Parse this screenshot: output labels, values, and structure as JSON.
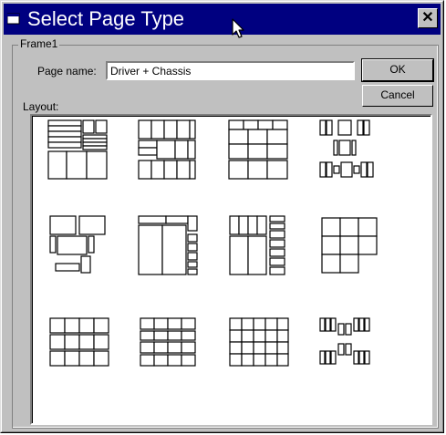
{
  "window": {
    "title": "Select Page Type",
    "close_glyph": "✕"
  },
  "frame": {
    "label": "Frame1",
    "page_name_label": "Page name:",
    "page_name_value": "Driver + Chassis",
    "layout_label": "Layout:"
  },
  "buttons": {
    "ok": "OK",
    "cancel": "Cancel"
  },
  "layouts": [
    {
      "name": "layout-1"
    },
    {
      "name": "layout-2"
    },
    {
      "name": "layout-3"
    },
    {
      "name": "layout-4"
    },
    {
      "name": "layout-5"
    },
    {
      "name": "layout-6"
    },
    {
      "name": "layout-7"
    },
    {
      "name": "layout-8"
    },
    {
      "name": "layout-9"
    },
    {
      "name": "layout-10"
    },
    {
      "name": "layout-11"
    },
    {
      "name": "layout-12"
    }
  ],
  "icons": {
    "title": "window-icon",
    "cursor": "mouse-pointer-icon"
  }
}
